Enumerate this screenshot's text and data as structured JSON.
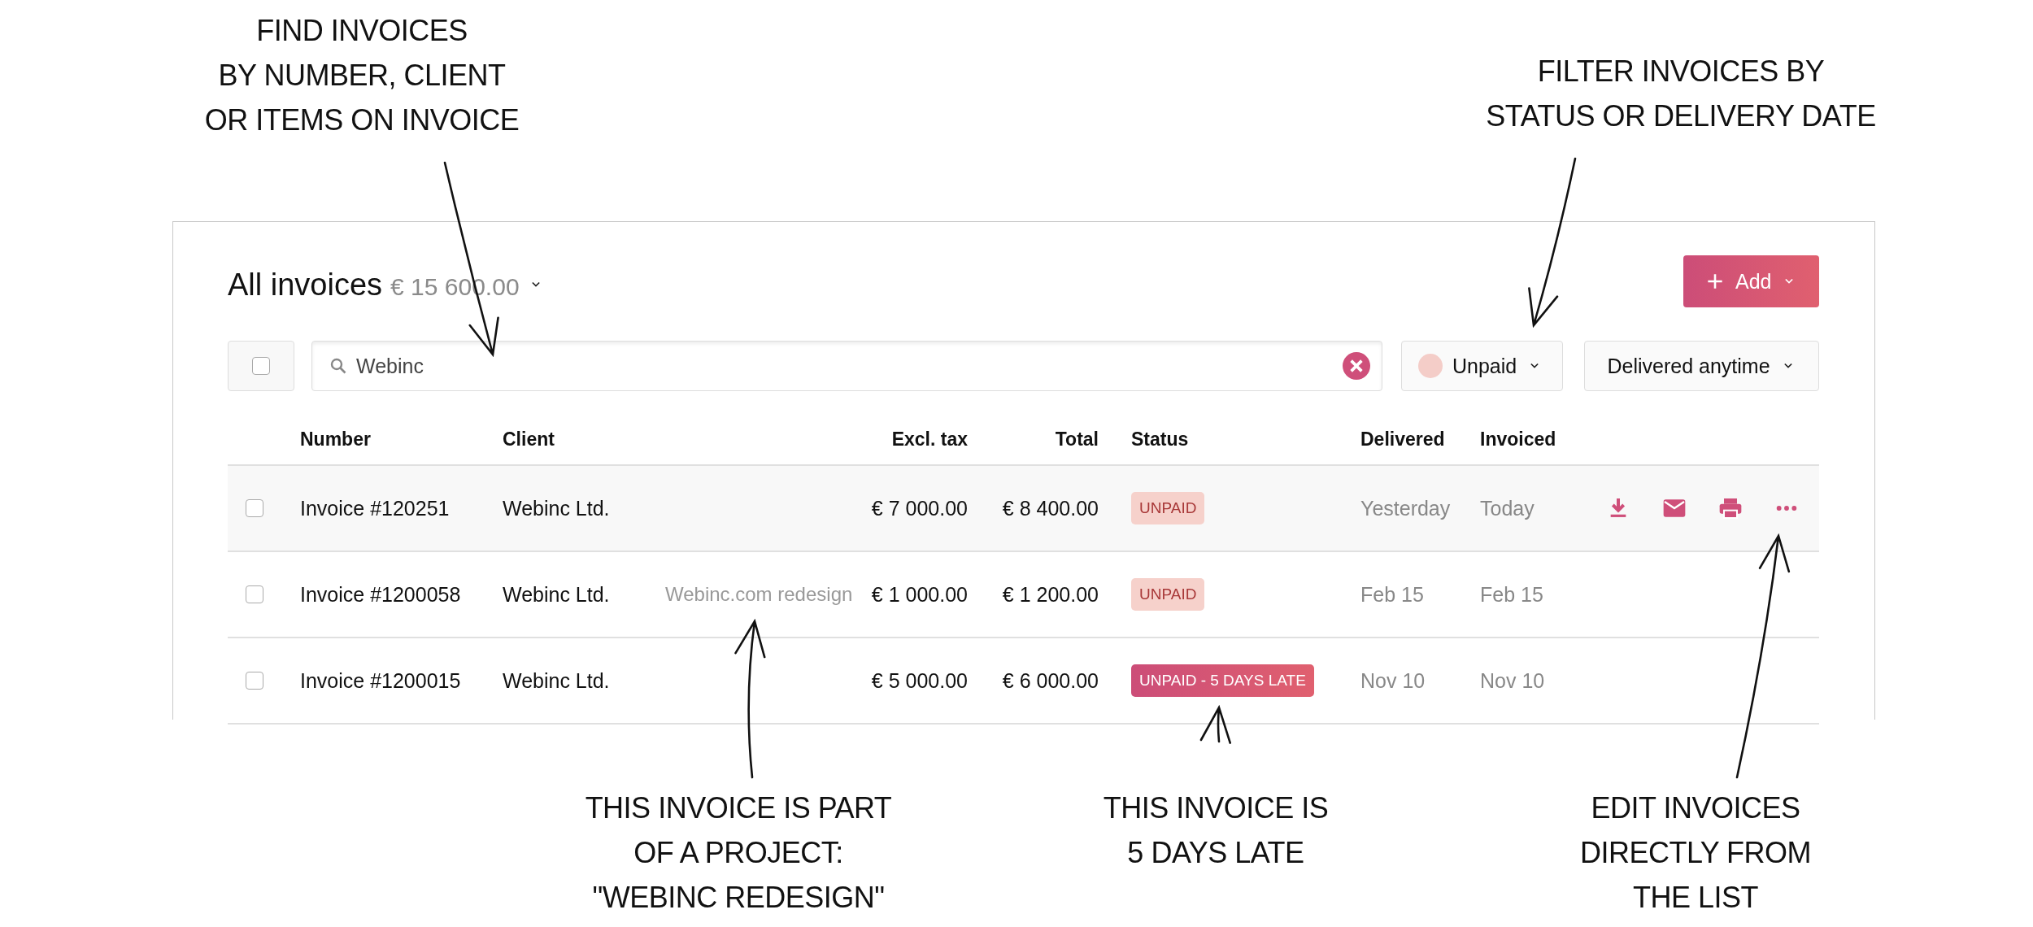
{
  "annotations": [
    {
      "lines": [
        "FIND INVOICES",
        "BY NUMBER, CLIENT",
        "OR ITEMS ON INVOICE"
      ]
    },
    {
      "lines": [
        "FILTER INVOICES BY",
        "STATUS OR DELIVERY DATE"
      ]
    },
    {
      "lines": [
        "THIS INVOICE IS PART",
        "OF A PROJECT:",
        "\"WEBINC REDESIGN\""
      ]
    },
    {
      "lines": [
        "THIS INVOICE IS",
        "5 DAYS LATE"
      ]
    },
    {
      "lines": [
        "EDIT INVOICES",
        "DIRECTLY FROM",
        "THE LIST"
      ]
    }
  ],
  "header": {
    "title": "All invoices",
    "total": "€ 15 600.00"
  },
  "add_button": {
    "label": "Add"
  },
  "select_all": {
    "checked": false
  },
  "search": {
    "value": "Webinc"
  },
  "filters": [
    {
      "label": "Unpaid",
      "color": "#f4cdc8"
    },
    {
      "label": "Delivered anytime"
    }
  ],
  "table": {
    "columns": [
      "Number",
      "Client",
      "Excl. tax",
      "Total",
      "Status",
      "Delivered",
      "Invoiced"
    ],
    "rows": [
      {
        "checked": false,
        "hovered": true,
        "number": "Invoice #120251",
        "client": "Webinc Ltd.",
        "excl_tax": "€ 7 000.00",
        "total": "€ 8 400.00",
        "status": {
          "label": "UNPAID",
          "kind": "unpaid"
        },
        "delivered": "Yesterday",
        "invoiced": "Today"
      },
      {
        "checked": false,
        "hovered": false,
        "number": "Invoice #1200058",
        "client": "Webinc Ltd.",
        "project": "Webinc.com redesign",
        "excl_tax": "€ 1 000.00",
        "total": "€ 1 200.00",
        "status": {
          "label": "UNPAID",
          "kind": "unpaid"
        },
        "delivered": "Feb 15",
        "invoiced": "Feb 15"
      },
      {
        "checked": false,
        "hovered": false,
        "number": "Invoice #1200015",
        "client": "Webinc Ltd.",
        "excl_tax": "€ 5 000.00",
        "total": "€ 6 000.00",
        "status": {
          "label": "UNPAID - 5 DAYS LATE",
          "kind": "late"
        },
        "delivered": "Nov 10",
        "invoiced": "Nov 10"
      }
    ]
  }
}
